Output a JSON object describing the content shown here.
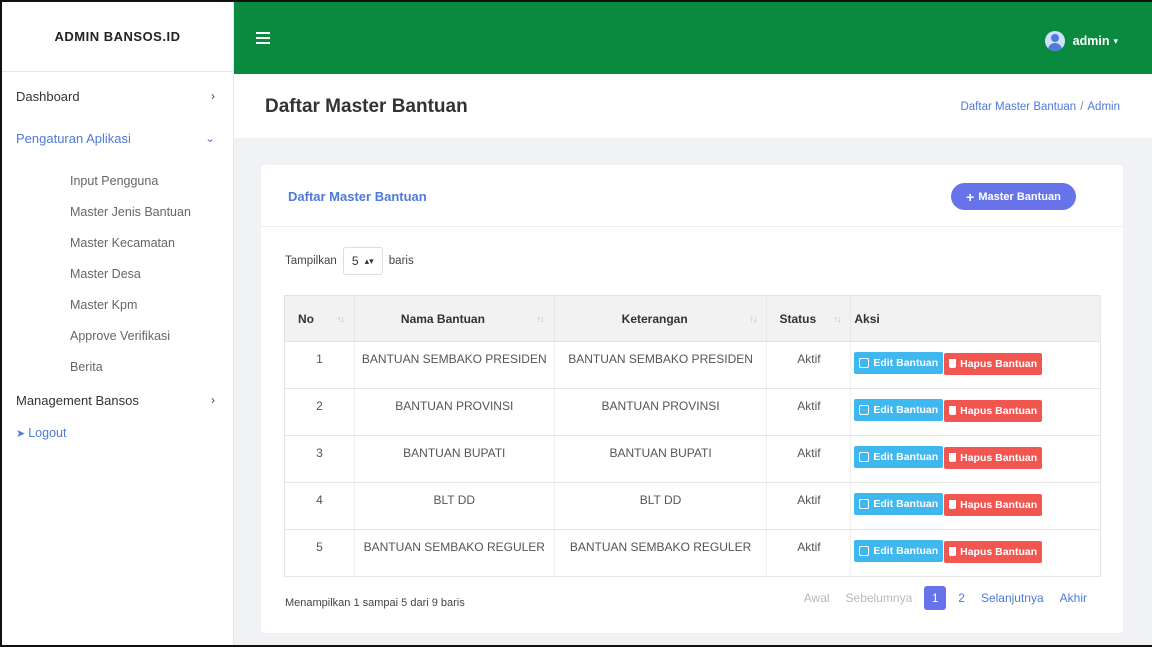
{
  "brand": "ADMIN BANSOS.ID",
  "sidebar": {
    "items": [
      {
        "label": "Dashboard"
      },
      {
        "label": "Pengaturan Aplikasi"
      },
      {
        "label": "Management Bansos"
      }
    ],
    "submenu": [
      "Input Pengguna",
      "Master Jenis Bantuan",
      "Master Kecamatan",
      "Master Desa",
      "Master Kpm",
      "Approve Verifikasi",
      "Berita"
    ],
    "logout": "Logout"
  },
  "topbar": {
    "user": "admin"
  },
  "page": {
    "title": "Daftar Master Bantuan",
    "breadcrumb": [
      "Daftar Master Bantuan",
      "Admin"
    ]
  },
  "card": {
    "title": "Daftar Master Bantuan",
    "add_button": "Master Bantuan",
    "length_prefix": "Tampilkan",
    "length_value": "5",
    "length_suffix": "baris"
  },
  "table": {
    "headers": [
      "No",
      "Nama Bantuan",
      "Keterangan",
      "Status",
      "Aksi"
    ],
    "rows": [
      {
        "no": "1",
        "nama": "BANTUAN SEMBAKO PRESIDEN",
        "ket": "BANTUAN SEMBAKO PRESIDEN",
        "status": "Aktif"
      },
      {
        "no": "2",
        "nama": "BANTUAN PROVINSI",
        "ket": "BANTUAN PROVINSI",
        "status": "Aktif"
      },
      {
        "no": "3",
        "nama": "BANTUAN BUPATI",
        "ket": "BANTUAN BUPATI",
        "status": "Aktif"
      },
      {
        "no": "4",
        "nama": "BLT DD",
        "ket": "BLT DD",
        "status": "Aktif"
      },
      {
        "no": "5",
        "nama": "BANTUAN SEMBAKO REGULER",
        "ket": "BANTUAN SEMBAKO REGULER",
        "status": "Aktif"
      }
    ],
    "edit_label": "Edit Bantuan",
    "delete_label": "Hapus Bantuan"
  },
  "footer": {
    "info": "Menampilkan 1 sampai 5 dari 9 baris",
    "pager": {
      "first": "Awal",
      "prev": "Sebelumnya",
      "pages": [
        "1",
        "2"
      ],
      "next": "Selanjutnya",
      "last": "Akhir"
    }
  },
  "colors": {
    "topbar": "#0a8a3f",
    "accent": "#6673e9",
    "edit": "#3fb7ef",
    "delete": "#f25650",
    "link": "#4f7ad9"
  },
  "icons": [
    "hamburger-icon",
    "user-avatar-icon",
    "chevron-right-icon",
    "chevron-down-icon",
    "logout-icon",
    "plus-icon",
    "edit-icon",
    "trash-icon",
    "sort-icon"
  ]
}
